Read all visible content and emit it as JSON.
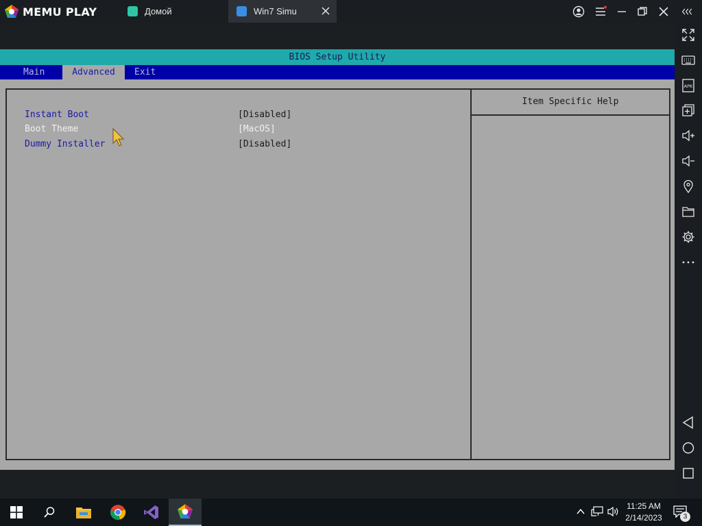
{
  "app": {
    "brand": "MEMU PLAY"
  },
  "tabs": [
    {
      "label": "Домой"
    },
    {
      "label": "Win7 Simu"
    }
  ],
  "bios": {
    "title": "BIOS Setup Utility",
    "menu": [
      "Main",
      "Advanced",
      "Exit"
    ],
    "selected_menu": "Advanced",
    "options": [
      {
        "label": "Instant Boot",
        "value": "[Disabled]"
      },
      {
        "label": "Boot Theme",
        "value": "[MacOS]"
      },
      {
        "label": "Dummy Installer",
        "value": "[Disabled]"
      }
    ],
    "help_title": "Item Specific Help"
  },
  "sidebar_icons": [
    "fullscreen-icon",
    "keyboard-icon",
    "apk-icon",
    "add-window-icon",
    "volume-up-icon",
    "volume-down-icon",
    "location-icon",
    "folder-icon",
    "settings-icon",
    "more-icon",
    "back-icon",
    "home-icon",
    "recents-icon"
  ],
  "taskbar": {
    "time": "11:25 AM",
    "date": "2/14/2023",
    "notification_count": "3"
  },
  "colors": {
    "bios_bg": "#a8a8a8",
    "bios_title_bar": "#1fa9ab",
    "bios_menu_bar": "#0000a8",
    "bios_option_label": "#1a1aa8",
    "chrome_bg": "#1a1d21"
  }
}
